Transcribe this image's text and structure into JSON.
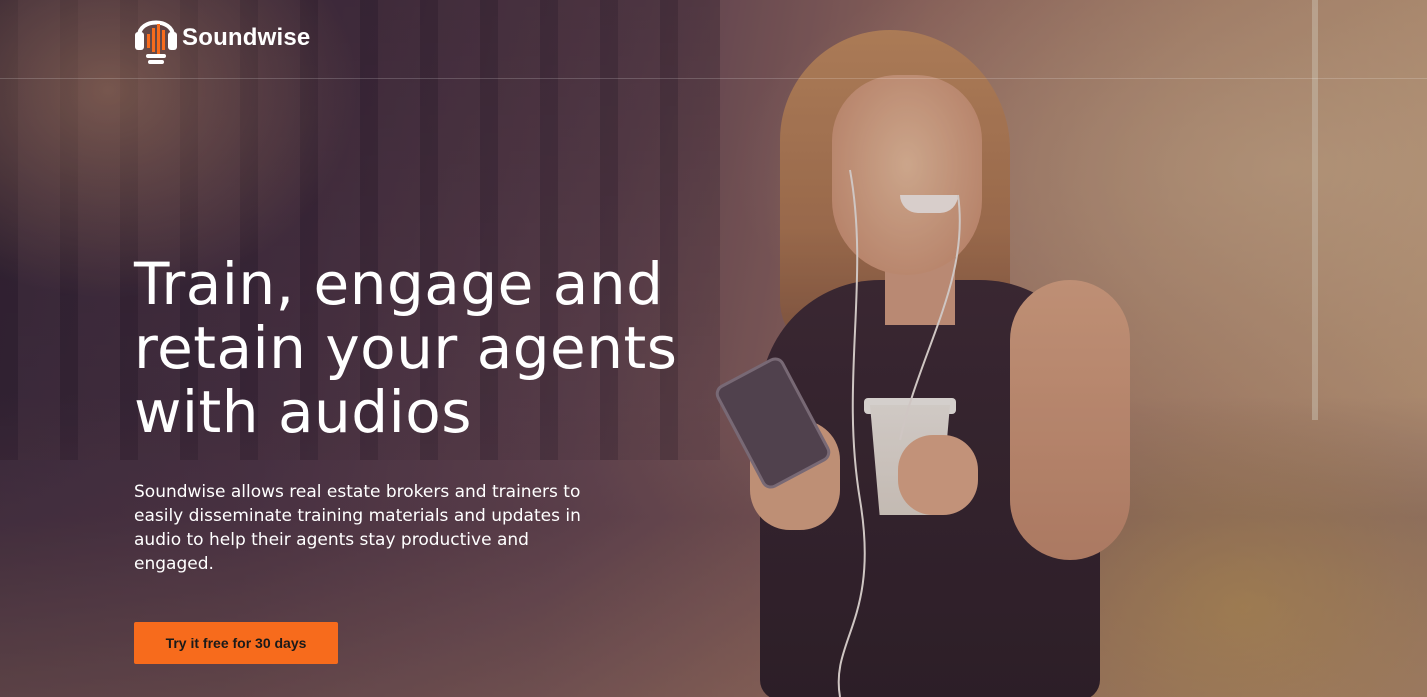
{
  "brand": {
    "name": "Soundwise",
    "icon": "headphones-soundwave-logo-icon",
    "accent_color": "#f76b1c"
  },
  "hero": {
    "headline": "Train, engage and retain your agents with audios",
    "description": "Soundwise allows real estate brokers and trainers to easily disseminate training materials and updates in audio to help their agents stay productive and engaged.",
    "cta_label": "Try it free for 30 days",
    "background_image": "woman-listening-with-earphones-holding-phone-and-coffee"
  }
}
